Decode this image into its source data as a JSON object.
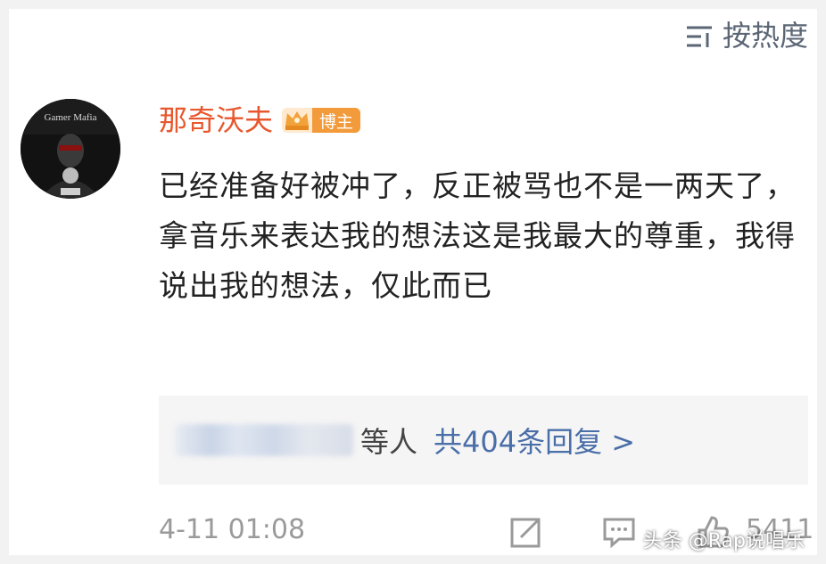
{
  "header": {
    "sort_label": "按热度",
    "sort_icon": "sort-icon"
  },
  "comment": {
    "avatar_icon": "avatar",
    "username": "那奇沃夫",
    "badge_label": "博主",
    "badge_icon": "crown-icon",
    "text": "已经准备好被冲了，反正被骂也不是一两天了，拿音乐来表达我的想法这是我最大的尊重，我得说出我的想法，仅此而已",
    "replies": {
      "others_text": "等人",
      "total_text": "共404条回复 >"
    },
    "footer": {
      "time": "4-11 01:08",
      "like_count": "5411",
      "icons": [
        "share-icon",
        "comment-icon",
        "like-icon"
      ]
    }
  },
  "watermark": "头条 @Rap说唱乐",
  "colors": {
    "username": "#e8582e",
    "link": "#4a6ea8",
    "meta": "#9a9a9a",
    "badge": "#f39a3a"
  }
}
